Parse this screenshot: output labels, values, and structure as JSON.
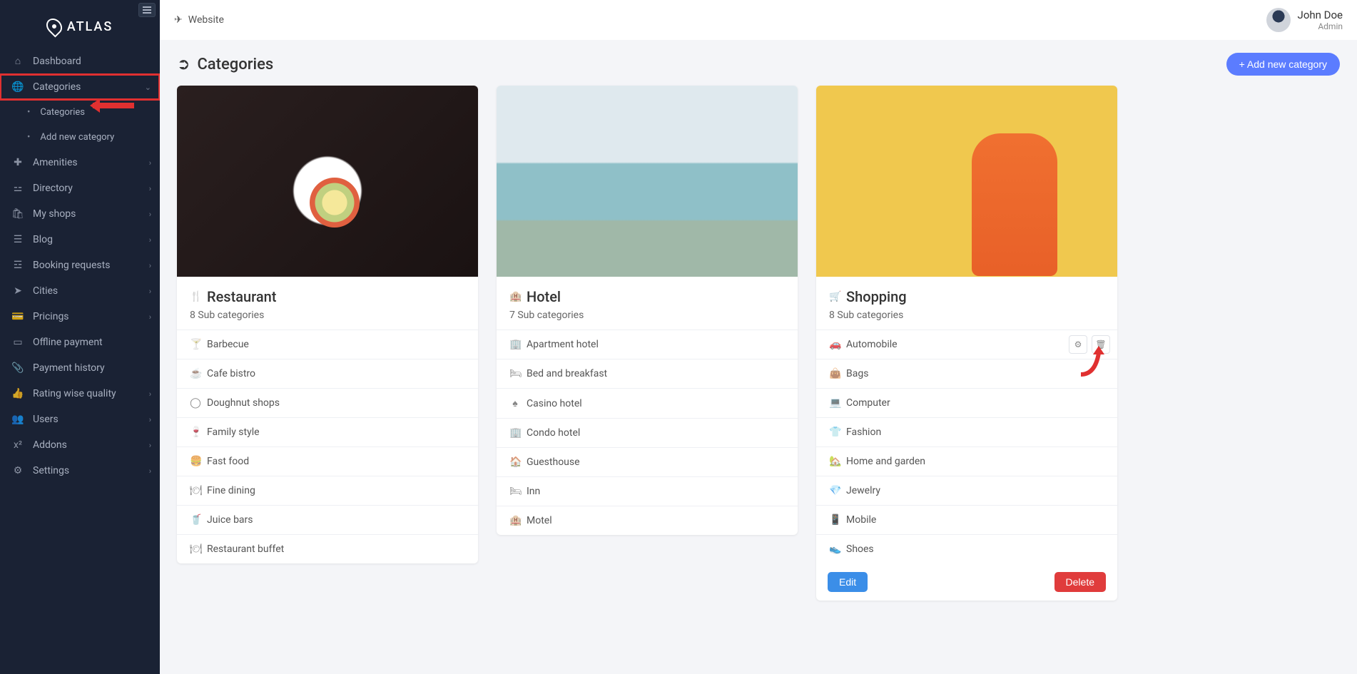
{
  "brand": "ATLAS",
  "topbar": {
    "website": "Website"
  },
  "user": {
    "name": "John Doe",
    "role": "Admin"
  },
  "page": {
    "title": "Categories",
    "add_btn": "+ Add new category"
  },
  "sidebar": {
    "dashboard": "Dashboard",
    "categories": "Categories",
    "sub_categories": "Categories",
    "sub_addnew": "Add new category",
    "amenities": "Amenities",
    "directory": "Directory",
    "myshops": "My shops",
    "blog": "Blog",
    "booking": "Booking requests",
    "cities": "Cities",
    "pricings": "Pricings",
    "offline": "Offline payment",
    "payment_history": "Payment history",
    "rating": "Rating wise quality",
    "users": "Users",
    "addons": "Addons",
    "settings": "Settings"
  },
  "cards": [
    {
      "title": "Restaurant",
      "sub": "8 Sub categories",
      "icon": "🍴",
      "items": [
        "Barbecue",
        "Cafe bistro",
        "Doughnut shops",
        "Family style",
        "Fast food",
        "Fine dining",
        "Juice bars",
        "Restaurant buffet"
      ],
      "item_icons": [
        "🍸",
        "☕",
        "◯",
        "🍷",
        "🍔",
        "🍽",
        "🥤",
        "🍽"
      ]
    },
    {
      "title": "Hotel",
      "sub": "7 Sub categories",
      "icon": "🏨",
      "items": [
        "Apartment hotel",
        "Bed and breakfast",
        "Casino hotel",
        "Condo hotel",
        "Guesthouse",
        "Inn",
        "Motel"
      ],
      "item_icons": [
        "🏢",
        "🛏",
        "♠",
        "🏢",
        "🏠",
        "🛏",
        "🏨"
      ]
    },
    {
      "title": "Shopping",
      "sub": "8 Sub categories",
      "icon": "🛒",
      "items": [
        "Automobile",
        "Bags",
        "Computer",
        "Fashion",
        "Home and garden",
        "Jewelry",
        "Mobile",
        "Shoes"
      ],
      "item_icons": [
        "🚗",
        "👜",
        "💻",
        "👕",
        "🏡",
        "💎",
        "📱",
        "👟"
      ]
    }
  ],
  "buttons": {
    "edit": "Edit",
    "delete": "Delete"
  }
}
